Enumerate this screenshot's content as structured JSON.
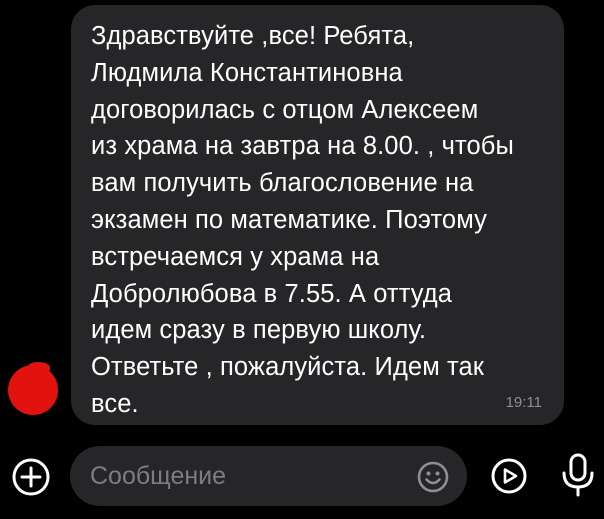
{
  "message": {
    "lines": [
      "Здравствуйте ,все! Ребята,",
      "Людмила Константиновна",
      "договорилась с отцом Алексеем",
      "из храма на завтра на 8.00. , чтобы",
      "вам получить благословение на",
      "экзамен по математике. Поэтому",
      "встречаемся у храма на",
      "Добролюбова в 7.55. А оттуда",
      "идем сразу в первую школу.",
      "Ответьте , пожалуйста. Идем так",
      "все."
    ],
    "time": "19:11"
  },
  "composer": {
    "placeholder": "Сообщение"
  },
  "icons": {
    "attach": "plus-circle-icon",
    "emoji": "smile-icon",
    "send": "play-circle-icon",
    "mic": "microphone-icon"
  },
  "colors": {
    "background": "#000000",
    "bubble": "#262628",
    "text": "#ffffff",
    "muted": "#8e8e93",
    "avatar": "#e2130f"
  }
}
